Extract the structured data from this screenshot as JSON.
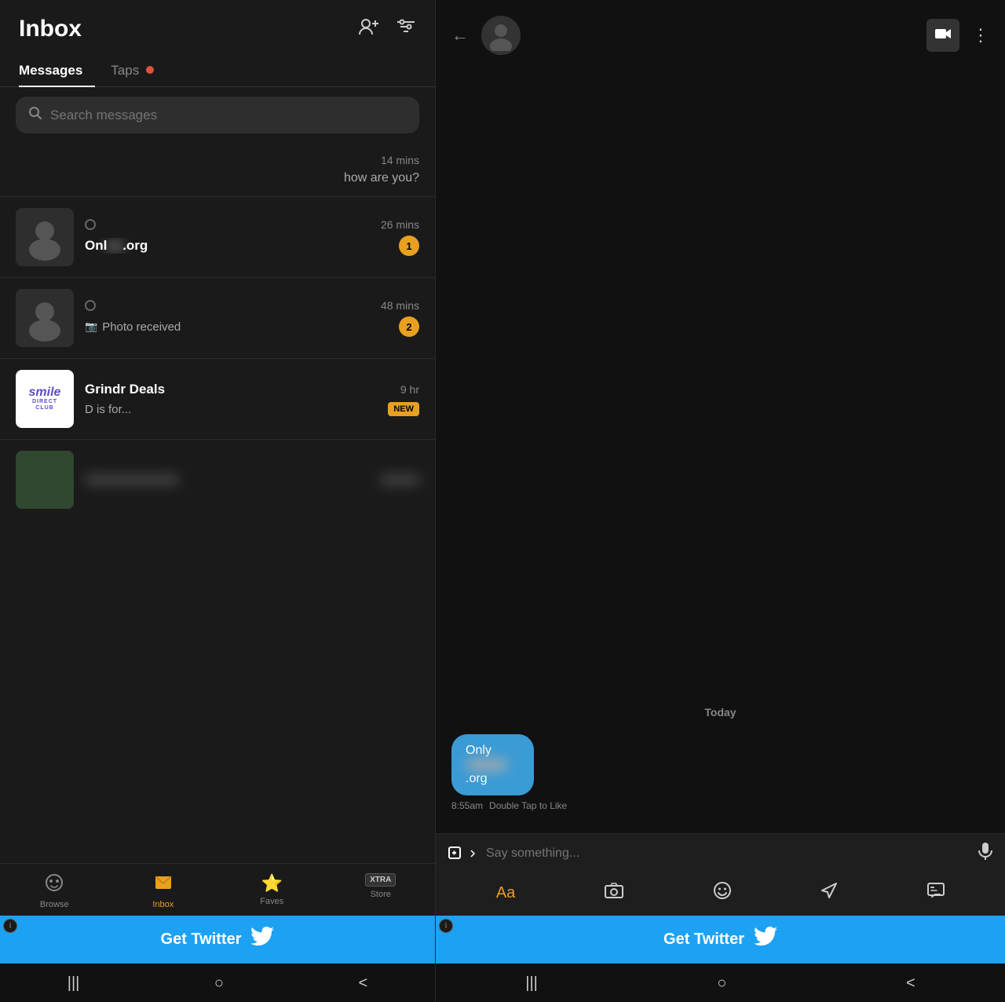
{
  "left": {
    "title": "Inbox",
    "tabs": [
      {
        "label": "Messages",
        "active": true
      },
      {
        "label": "Taps",
        "badge": true
      }
    ],
    "search": {
      "placeholder": "Search messages"
    },
    "messages": [
      {
        "id": "partial-msg",
        "time": "14 mins",
        "preview": "how are you?",
        "partial": true
      },
      {
        "id": "msg1",
        "time": "26 mins",
        "name": "Onl___s.org",
        "name_visible": "Onl",
        "name_blurred": "___",
        "name_suffix": ".org",
        "preview": "",
        "unread": 1
      },
      {
        "id": "msg2",
        "time": "48 mins",
        "name": "",
        "preview": "Photo received",
        "unread": 2,
        "has_photo": true
      },
      {
        "id": "grindr-deals",
        "time": "9 hr",
        "name": "Grindr Deals",
        "preview": "D is for...",
        "badge": "NEW",
        "is_ad": false,
        "is_smile": false
      }
    ],
    "nav": [
      {
        "label": "Browse",
        "icon": "🐾",
        "active": false
      },
      {
        "label": "Inbox",
        "icon": "💬",
        "active": true
      },
      {
        "label": "Faves",
        "icon": "★",
        "active": false
      },
      {
        "label": "Store",
        "icon": "XTRA",
        "active": false,
        "is_xtra": true
      }
    ],
    "twitter_ad": {
      "text": "Get Twitter",
      "info": "i"
    }
  },
  "right": {
    "back_icon": "←",
    "video_icon": "📷",
    "more_icon": "⋮",
    "chat": {
      "date_divider": "Today",
      "bubble_text_prefix": "Only",
      "bubble_text_blurred": "___",
      "bubble_text_suffix": ".org",
      "bubble_time": "8:55am",
      "bubble_action": "Double Tap to Like"
    },
    "input": {
      "placeholder": "Say something..."
    },
    "toolbar": [
      {
        "icon": "Aa",
        "label": "text"
      },
      {
        "icon": "📷",
        "label": "camera"
      },
      {
        "icon": "😊",
        "label": "emoji"
      },
      {
        "icon": "✈",
        "label": "send"
      },
      {
        "icon": "❝",
        "label": "quote"
      }
    ],
    "twitter_ad": {
      "text": "Get Twitter",
      "info": "i"
    }
  },
  "android_nav": {
    "menu": "|||",
    "home": "○",
    "back": "<"
  }
}
